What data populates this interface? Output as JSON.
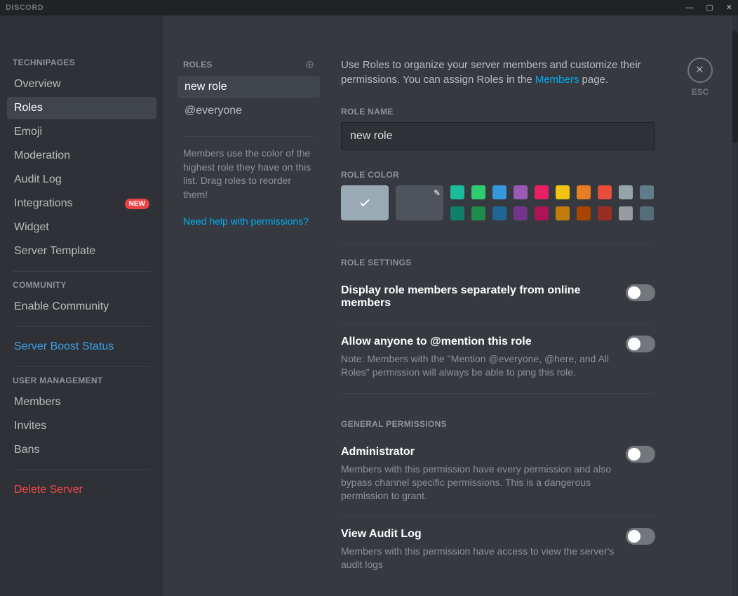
{
  "titlebar": {
    "brand": "DISCORD"
  },
  "sidebar": {
    "server_header": "TECHNIPAGES",
    "items_server": [
      {
        "label": "Overview",
        "key": "overview"
      },
      {
        "label": "Roles",
        "key": "roles",
        "active": true
      },
      {
        "label": "Emoji",
        "key": "emoji"
      },
      {
        "label": "Moderation",
        "key": "moderation"
      },
      {
        "label": "Audit Log",
        "key": "audit-log"
      },
      {
        "label": "Integrations",
        "key": "integrations",
        "badge": "NEW"
      },
      {
        "label": "Widget",
        "key": "widget"
      },
      {
        "label": "Server Template",
        "key": "server-template"
      }
    ],
    "community_header": "COMMUNITY",
    "community_item": "Enable Community",
    "boost_item": "Server Boost Status",
    "user_mgmt_header": "USER MANAGEMENT",
    "items_user": [
      {
        "label": "Members",
        "key": "members"
      },
      {
        "label": "Invites",
        "key": "invites"
      },
      {
        "label": "Bans",
        "key": "bans"
      }
    ],
    "delete_server": "Delete Server"
  },
  "roles_col": {
    "header": "ROLES",
    "items": [
      {
        "label": "new role",
        "selected": true
      },
      {
        "label": "@everyone"
      }
    ],
    "note": "Members use the color of the highest role they have on this list. Drag roles to reorder them!",
    "help_link": "Need help with permissions?"
  },
  "main": {
    "intro_prefix": "Use Roles to organize your server members and customize their permissions. You can assign Roles in the ",
    "intro_link": "Members",
    "intro_suffix": " page.",
    "role_name_label": "ROLE NAME",
    "role_name_value": "new role",
    "role_color_label": "ROLE COLOR",
    "colors_row1": [
      "#1abc9c",
      "#2ecc71",
      "#3498db",
      "#9b59b6",
      "#e91e63",
      "#f1c40f",
      "#e67e22",
      "#e74c3c",
      "#95a5a6",
      "#607d8b"
    ],
    "colors_row2": [
      "#11806a",
      "#1f8b4c",
      "#206694",
      "#71368a",
      "#ad1457",
      "#c27c0e",
      "#a84300",
      "#992d22",
      "#979c9f",
      "#546e7a"
    ],
    "role_settings_label": "ROLE SETTINGS",
    "separate_title": "Display role members separately from online members",
    "mention_title_prefix": "Allow anyone to ",
    "mention_title_mention": "@mention",
    "mention_title_suffix": " this role",
    "mention_note": "Note: Members with the \"Mention @everyone, @here, and All Roles\" permission will always be able to ping this role.",
    "general_perms_label": "GENERAL PERMISSIONS",
    "admin_title": "Administrator",
    "admin_note": "Members with this permission have every permission and also bypass channel specific permissions. This is a dangerous permission to grant.",
    "audit_title": "View Audit Log",
    "audit_note": "Members with this permission have access to view the server's audit logs",
    "close_label": "ESC"
  }
}
